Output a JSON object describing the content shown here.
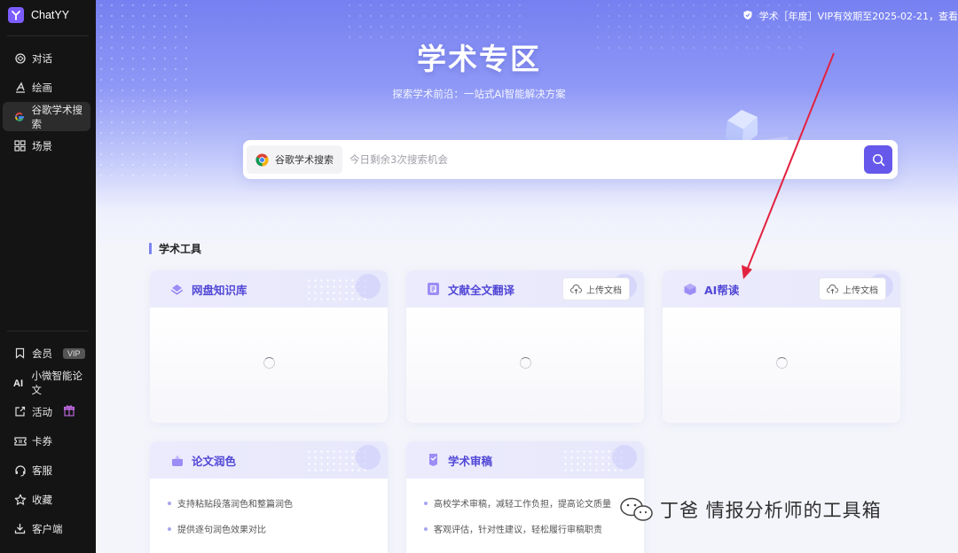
{
  "app": {
    "name": "ChatYY"
  },
  "sidebar": {
    "top_items": [
      {
        "label": "对话",
        "icon": "chatgpt-icon"
      },
      {
        "label": "绘画",
        "icon": "paint-icon"
      },
      {
        "label": "谷歌学术搜索",
        "icon": "google-icon",
        "active": true
      },
      {
        "label": "场景",
        "icon": "grid-icon"
      }
    ],
    "bottom_items": [
      {
        "label": "会员",
        "icon": "bookmark-icon",
        "badge": "VIP"
      },
      {
        "label": "小微智能论文",
        "icon": "ai-icon"
      },
      {
        "label": "活动",
        "icon": "external-icon"
      },
      {
        "label": "卡券",
        "icon": "ticket-icon"
      },
      {
        "label": "客服",
        "icon": "headset-icon"
      },
      {
        "label": "收藏",
        "icon": "star-icon"
      },
      {
        "label": "客户端",
        "icon": "download-icon"
      }
    ]
  },
  "header": {
    "vip_notice": "学术［年度］VIP有效期至2025-02-21，查看"
  },
  "hero": {
    "title": "学术专区",
    "subtitle": "探索学术前沿：一站式AI智能解决方案"
  },
  "search": {
    "engine_label": "谷歌学术搜索",
    "placeholder": "今日剩余3次搜索机会"
  },
  "tools": {
    "section_title": "学术工具",
    "cards": [
      {
        "title": "网盘知识库"
      },
      {
        "title": "文献全文翻译",
        "upload_label": "上传文档"
      },
      {
        "title": "AI帮读",
        "upload_label": "上传文档"
      },
      {
        "title": "论文润色",
        "features": [
          "支持粘贴段落润色和整篇润色",
          "提供逐句润色效果对比"
        ]
      },
      {
        "title": "学术审稿",
        "features": [
          "高校学术审稿，减轻工作负担，提高论文质量",
          "客观评估，针对性建议，轻松履行审稿职责"
        ]
      }
    ]
  },
  "watermark": {
    "text": "丁爸 情报分析师的工具箱"
  },
  "colors": {
    "accent": "#6558ea",
    "sidebar_bg": "#141414",
    "annotation_arrow": "#e2233f"
  }
}
